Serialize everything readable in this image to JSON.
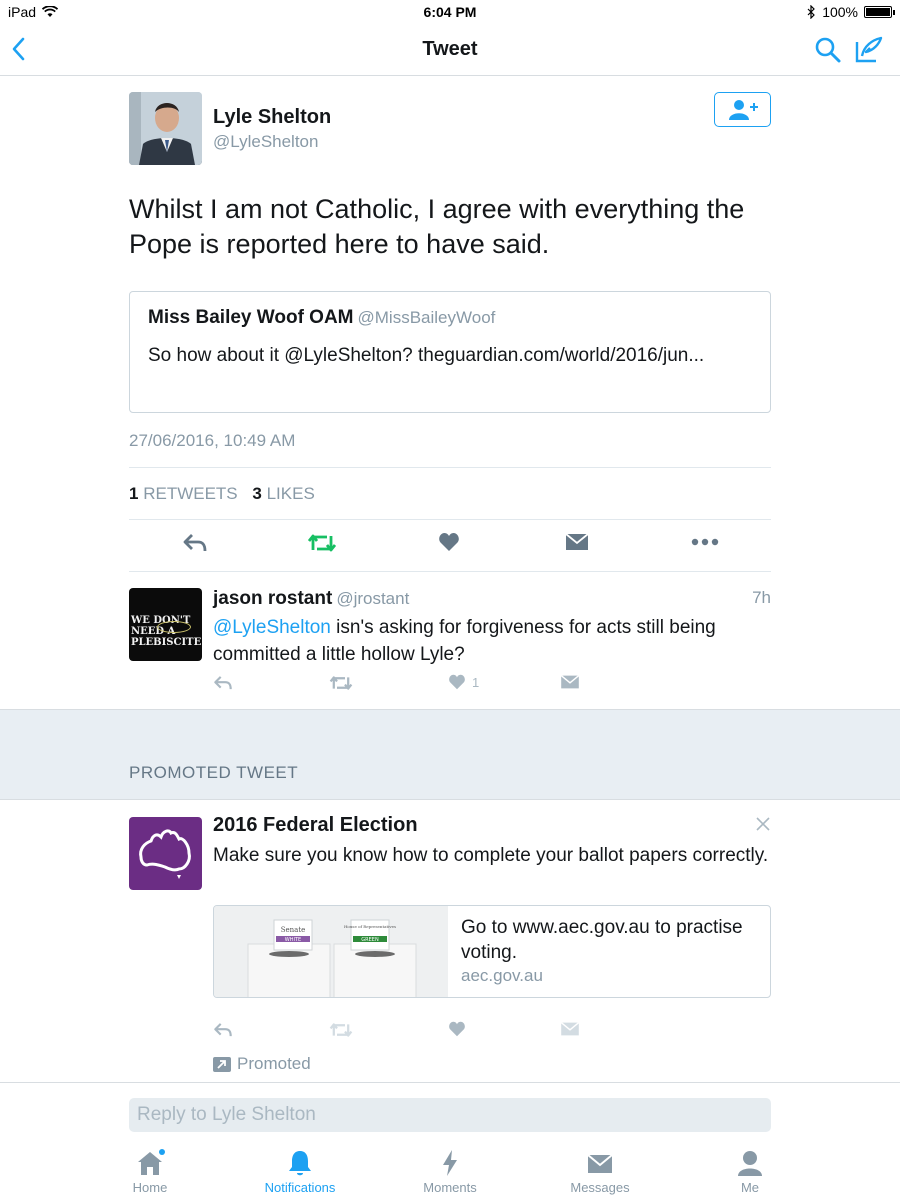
{
  "status_bar": {
    "device": "iPad",
    "time": "6:04 PM",
    "battery": "100%",
    "battery_level": 1.0
  },
  "nav": {
    "title": "Tweet",
    "icons": [
      "back-chevron-icon",
      "search-icon",
      "compose-icon"
    ]
  },
  "colors": {
    "accent": "#1da1f2",
    "retweet_green": "#17bf63",
    "muted": "#8899a6",
    "promo_purple": "#6b2d84"
  },
  "tweet": {
    "author_name": "Lyle Shelton",
    "author_handle": "@LyleShelton",
    "text": "Whilst I am not Catholic, I agree with everything the Pope is reported here to have said.",
    "quote": {
      "name": "Miss Bailey Woof OAM",
      "handle": "@MissBaileyWoof",
      "text": "So how about it @LyleShelton?  theguardian.com/world/2016/jun..."
    },
    "timestamp": "27/06/2016, 10:49 AM",
    "retweet_count": "1",
    "retweet_label": "RETWEETS",
    "like_count": "3",
    "like_label": "LIKES"
  },
  "reply": {
    "name": "jason rostant",
    "handle": "@jrostant",
    "time": "7h",
    "mention": "@LyleShelton",
    "text": " isn's asking for forgiveness for acts still being committed a little hollow Lyle?",
    "like_count": "1",
    "avatar_text": "WE DON'T NEED A PLEBISCITE."
  },
  "promoted_section": {
    "label": "PROMOTED TWEET"
  },
  "promo": {
    "name": "2016 Federal Election",
    "text": "Make sure you know how to complete your ballot papers correctly.",
    "card_title": "Go to www.aec.gov.au to practise voting.",
    "card_domain": "aec.gov.au",
    "card_box_left": "Senate",
    "card_box_left_color": "WHITE",
    "card_box_right": "House of Representatives",
    "card_box_right_color": "GREEN",
    "promoted_label": "Promoted"
  },
  "reply_bar": {
    "placeholder": "Reply to Lyle Shelton"
  },
  "tabs": [
    {
      "label": "Home",
      "icon": "home-icon"
    },
    {
      "label": "Notifications",
      "icon": "bell-icon"
    },
    {
      "label": "Moments",
      "icon": "lightning-icon"
    },
    {
      "label": "Messages",
      "icon": "envelope-icon"
    },
    {
      "label": "Me",
      "icon": "person-icon"
    }
  ]
}
